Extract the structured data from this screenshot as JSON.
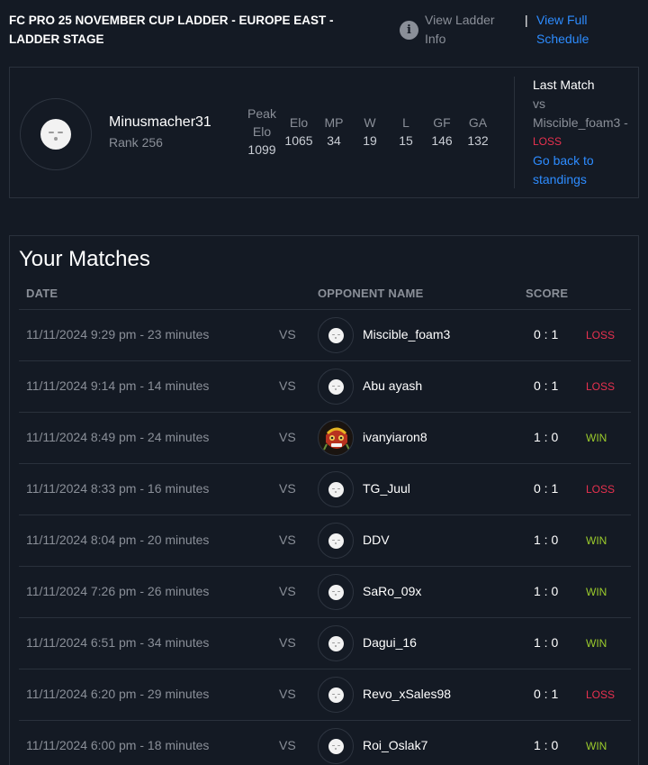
{
  "header": {
    "title": "FC PRO 25 NOVEMBER CUP LADDER - EUROPE EAST - LADDER STAGE",
    "info_icon": "i",
    "view_ladder_info": "View Ladder Info",
    "separator": "|",
    "view_full_schedule": "View Full Schedule"
  },
  "player": {
    "name": "Minusmacher31",
    "rank": "Rank 256",
    "stats": [
      {
        "label": "Peak Elo",
        "value": "1099"
      },
      {
        "label": "Elo",
        "value": "1065"
      },
      {
        "label": "MP",
        "value": "34"
      },
      {
        "label": "W",
        "value": "19"
      },
      {
        "label": "L",
        "value": "15"
      },
      {
        "label": "GF",
        "value": "146"
      },
      {
        "label": "GA",
        "value": "132"
      }
    ],
    "last_match": {
      "title": "Last Match",
      "vs": "vs",
      "opponent": "Miscible_foam3 -",
      "result": "LOSS",
      "back_link": "Go back to standings"
    }
  },
  "matches": {
    "title": "Your Matches",
    "columns": {
      "date": "DATE",
      "opponent": "OPPONENT NAME",
      "score": "SCORE"
    },
    "rows": [
      {
        "date": "11/11/2024 9:29 pm - 23 minutes",
        "vs": "VS",
        "opponent": "Miscible_foam3",
        "score": "0 : 1",
        "result": "LOSS",
        "avatar": "default-face"
      },
      {
        "date": "11/11/2024 9:14 pm - 14 minutes",
        "vs": "VS",
        "opponent": "Abu ayash",
        "score": "0 : 1",
        "result": "LOSS",
        "avatar": "default-face"
      },
      {
        "date": "11/11/2024 8:49 pm - 24 minutes",
        "vs": "VS",
        "opponent": "ivanyiaron8",
        "score": "1 : 0",
        "result": "WIN",
        "avatar": "mask-avatar"
      },
      {
        "date": "11/11/2024 8:33 pm - 16 minutes",
        "vs": "VS",
        "opponent": "TG_Juul",
        "score": "0 : 1",
        "result": "LOSS",
        "avatar": "default-face"
      },
      {
        "date": "11/11/2024 8:04 pm - 20 minutes",
        "vs": "VS",
        "opponent": "DDV",
        "score": "1 : 0",
        "result": "WIN",
        "avatar": "default-face"
      },
      {
        "date": "11/11/2024 7:26 pm - 26 minutes",
        "vs": "VS",
        "opponent": "SaRo_09x",
        "score": "1 : 0",
        "result": "WIN",
        "avatar": "default-face"
      },
      {
        "date": "11/11/2024 6:51 pm - 34 minutes",
        "vs": "VS",
        "opponent": "Dagui_16",
        "score": "1 : 0",
        "result": "WIN",
        "avatar": "default-face"
      },
      {
        "date": "11/11/2024 6:20 pm - 29 minutes",
        "vs": "VS",
        "opponent": "Revo_xSales98",
        "score": "0 : 1",
        "result": "LOSS",
        "avatar": "default-face"
      },
      {
        "date": "11/11/2024 6:00 pm - 18 minutes",
        "vs": "VS",
        "opponent": "Roi_Oslak7",
        "score": "1 : 0",
        "result": "WIN",
        "avatar": "default-face"
      }
    ]
  },
  "colors": {
    "background": "#141a24",
    "link": "#2d8cff",
    "loss": "#e8314f",
    "win": "#9ccc2c"
  }
}
